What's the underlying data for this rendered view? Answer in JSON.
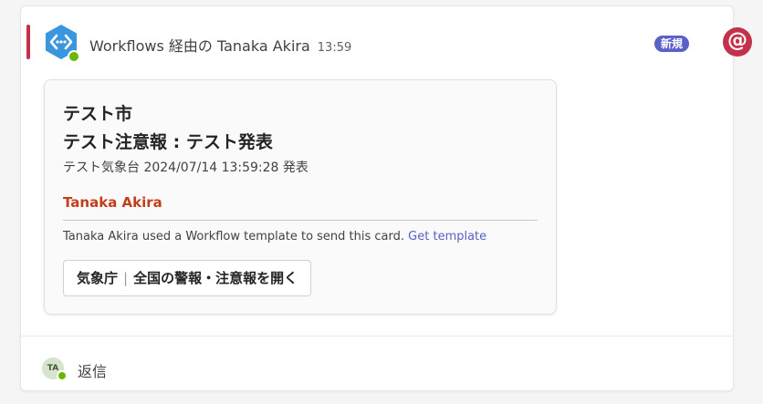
{
  "message": {
    "sender": "Workflows 経由の Tanaka Akira",
    "time": "13:59",
    "badge": "新規",
    "mention_symbol": "@",
    "colors": {
      "accent": "#c4314b",
      "badge": "#5b5fc7",
      "name_red": "#c43e1c",
      "presence": "#6bb700"
    },
    "app_icon": "workflows-icon"
  },
  "card": {
    "title_line1": "テスト市",
    "title_line2": "テスト注意報 : テスト発表",
    "subtitle": "テスト気象台 2024/07/14 13:59:28 発表",
    "person": "Tanaka Akira",
    "footer_text": "Tanaka Akira used a Workflow template to send this card.",
    "footer_link": "Get template",
    "button_part1": "気象庁",
    "button_sep": "|",
    "button_part2": "全国の警報・注意報を開く"
  },
  "reply": {
    "avatar_initials": "TA",
    "label": "返信"
  }
}
